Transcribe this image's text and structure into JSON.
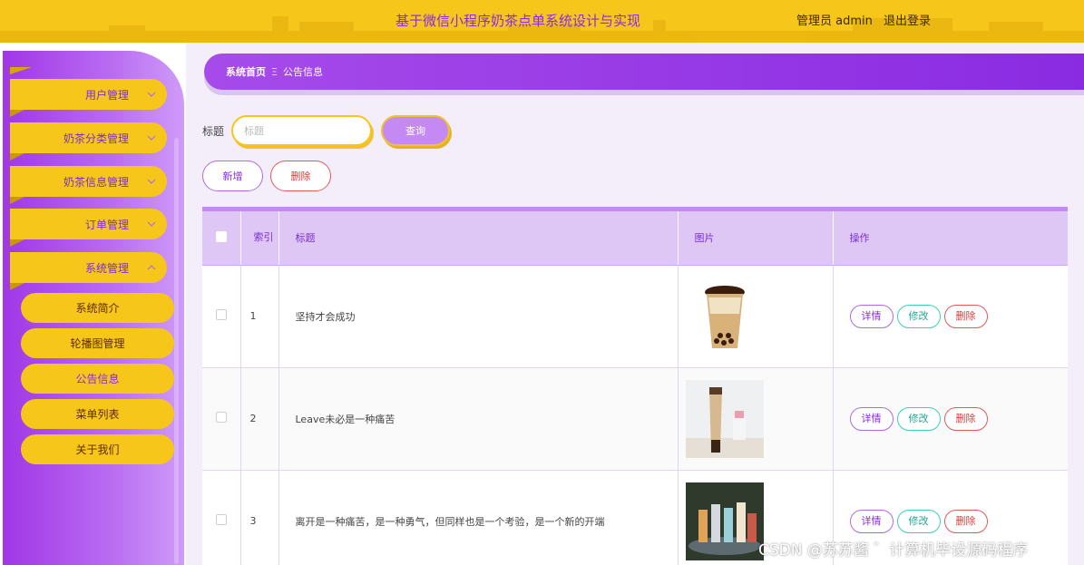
{
  "header": {
    "title": "基于微信小程序奶茶点单系统设计与实现",
    "user_role": "管理员",
    "username": "admin",
    "logout": "退出登录"
  },
  "sidebar": {
    "menus": [
      {
        "label": "用户管理"
      },
      {
        "label": "奶茶分类管理"
      },
      {
        "label": "奶茶信息管理"
      },
      {
        "label": "订单管理"
      },
      {
        "label": "系统管理"
      }
    ],
    "sub_items": [
      {
        "label": "系统简介"
      },
      {
        "label": "轮播图管理"
      },
      {
        "label": "公告信息"
      },
      {
        "label": "菜单列表"
      },
      {
        "label": "关于我们"
      }
    ]
  },
  "breadcrumb": {
    "home": "系统首页",
    "sep": "Ξ",
    "current": "公告信息"
  },
  "search": {
    "label": "标题",
    "placeholder": "标题",
    "query_button": "查询"
  },
  "actions": {
    "add": "新增",
    "delete": "删除"
  },
  "table": {
    "headers": {
      "index": "索引",
      "title": "标题",
      "image": "图片",
      "ops": "操作"
    },
    "ops": {
      "detail": "详情",
      "edit": "修改",
      "delete": "删除"
    },
    "rows": [
      {
        "index": "1",
        "title": "坚持才会成功"
      },
      {
        "index": "2",
        "title": "Leave未必是一种痛苦"
      },
      {
        "index": "3",
        "title": "离开是一种痛苦，是一种勇气，但同样也是一个考验，是一个新的开端"
      }
    ]
  },
  "watermark": "CSDN @苏苏酱 ゛计算机毕设源码程序",
  "colors": {
    "accent_purple": "#8a2be2",
    "accent_yellow": "#f7c61a",
    "edit_green": "#20a892",
    "danger_red": "#d63c3c"
  }
}
